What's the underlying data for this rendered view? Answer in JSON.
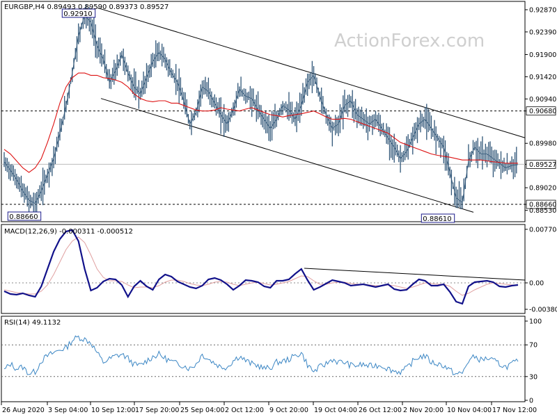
{
  "watermark": "ActionForex.com",
  "colors": {
    "price": "#2f5577",
    "ma": "#d11",
    "macd": "#11118a",
    "signal": "#e0a0a0",
    "rsi": "#3b86c4",
    "trend": "#000000",
    "dashed": "#000000",
    "box": "#1a1a8a"
  },
  "chart_data": [
    {
      "type": "line",
      "panel": "price",
      "title": "EURGBP,H4  0.89493 0.89590 0.89373 0.89527",
      "ylim": [
        0.883,
        0.9302
      ],
      "y_ticks": [
        "0.92870",
        "0.92390",
        "0.91900",
        "0.91420",
        "0.90940",
        "0.90680",
        "0.89980",
        "0.89527",
        "0.89020",
        "0.88660",
        "0.88530"
      ],
      "x_labels": [
        "26 Aug 2020",
        "3 Sep 04:00",
        "10 Sep 12:00",
        "17 Sep 20:00",
        "25 Sep 04:00",
        "2 Oct 12:00",
        "9 Oct 20:00",
        "19 Oct 04:00",
        "26 Oct 12:00",
        "2 Nov 20:00",
        "10 Nov 04:00",
        "17 Nov 12:00"
      ],
      "series": [
        {
          "values": [
            0.8958,
            0.894,
            0.892,
            0.8895,
            0.8875,
            0.8868,
            0.8895,
            0.893,
            0.8965,
            0.902,
            0.908,
            0.915,
            0.923,
            0.9275,
            0.926,
            0.921,
            0.918,
            0.913,
            0.9155,
            0.919,
            0.915,
            0.912,
            0.9105,
            0.914,
            0.9175,
            0.9195,
            0.918,
            0.915,
            0.913,
            0.909,
            0.904,
            0.9065,
            0.912,
            0.911,
            0.9085,
            0.906,
            0.904,
            0.907,
            0.9115,
            0.91,
            0.9095,
            0.907,
            0.905,
            0.903,
            0.905,
            0.908,
            0.907,
            0.905,
            0.908,
            0.913,
            0.9145,
            0.91,
            0.906,
            0.903,
            0.904,
            0.908,
            0.909,
            0.906,
            0.905,
            0.904,
            0.905,
            0.903,
            0.901,
            0.899,
            0.8965,
            0.898,
            0.901,
            0.904,
            0.905,
            0.903,
            0.901,
            0.899,
            0.8935,
            0.888,
            0.887,
            0.896,
            0.899,
            0.8975,
            0.8975,
            0.8965,
            0.8955,
            0.8945,
            0.895,
            0.8952
          ]
        },
        {
          "values": [
            0.8985,
            0.8975,
            0.896,
            0.8945,
            0.8935,
            0.8945,
            0.8965,
            0.9,
            0.904,
            0.9085,
            0.912,
            0.914,
            0.915,
            0.915,
            0.9145,
            0.9145,
            0.914,
            0.9138,
            0.9135,
            0.913,
            0.912,
            0.9105,
            0.9095,
            0.909,
            0.9088,
            0.909,
            0.909,
            0.9085,
            0.9085,
            0.908,
            0.9075,
            0.907,
            0.9068,
            0.9068,
            0.907,
            0.9075,
            0.9072,
            0.907,
            0.9068,
            0.9072,
            0.9075,
            0.907,
            0.9065,
            0.906,
            0.9058,
            0.9055,
            0.9058,
            0.906,
            0.9062,
            0.9065,
            0.9068,
            0.9062,
            0.9055,
            0.905,
            0.905,
            0.9052,
            0.905,
            0.9045,
            0.904,
            0.9035,
            0.903,
            0.9025,
            0.902,
            0.901,
            0.9,
            0.8995,
            0.899,
            0.8985,
            0.898,
            0.8975,
            0.8972,
            0.897,
            0.8968,
            0.8965,
            0.8962,
            0.8962,
            0.8962,
            0.8962,
            0.896,
            0.8958,
            0.8957,
            0.8955,
            0.8955,
            0.8955
          ]
        }
      ],
      "annotations": [
        "0.92910",
        "0.88660",
        "0.88610",
        "0.90680",
        "0.89527",
        "0.88660"
      ]
    },
    {
      "type": "line",
      "panel": "macd",
      "title": "MACD(12,26,9) -0.000311 -0.000512",
      "ylim": [
        -0.0042,
        0.0081
      ],
      "y_ticks": [
        "0.007704",
        "0.00",
        "-0.003804"
      ],
      "series": [
        {
          "values": [
            -0.0012,
            -0.0016,
            -0.0017,
            -0.0015,
            -0.0018,
            -0.002,
            -0.0005,
            0.002,
            0.0045,
            0.0063,
            0.0074,
            0.0076,
            0.006,
            0.002,
            -0.0011,
            -0.0007,
            0.0002,
            0.0006,
            0.0005,
            -0.0003,
            -0.002,
            -0.0005,
            0.0003,
            -0.0005,
            -0.001,
            0.0005,
            0.0012,
            0.0009,
            0.0002,
            -0.0002,
            -0.0006,
            -0.0008,
            -0.0004,
            0.0005,
            0.0007,
            0.0004,
            -0.0002,
            -0.001,
            -0.0004,
            0.0004,
            0.0003,
            0.0001,
            -0.0005,
            -0.0007,
            0.0003,
            0.0003,
            0.0005,
            0.0013,
            0.002,
            0.0004,
            -0.001,
            -0.0006,
            -0.0001,
            0.0004,
            0.0002,
            0.0,
            -0.0004,
            -0.0003,
            -0.0002,
            -0.0004,
            -0.0006,
            -0.0004,
            -0.0002,
            -0.0009,
            -0.0011,
            -0.001,
            -0.0002,
            0.0005,
            0.0003,
            -0.0004,
            -0.0004,
            -0.0002,
            -0.0013,
            -0.0027,
            -0.003,
            -0.0005,
            0.0001,
            0.0002,
            0.0003,
            0.0001,
            -0.0005,
            -0.0006,
            -0.0004,
            -0.0003
          ]
        },
        {
          "values": [
            -0.001,
            -0.0012,
            -0.0014,
            -0.0015,
            -0.0016,
            -0.0016,
            -0.0012,
            -0.0003,
            0.0012,
            0.003,
            0.0048,
            0.006,
            0.0066,
            0.0058,
            0.004,
            0.002,
            0.0008,
            0.0003,
            0.0003,
            0.0002,
            -0.0003,
            -0.0007,
            -0.0006,
            -0.0006,
            -0.0007,
            -0.0004,
            0.0001,
            0.0004,
            0.0004,
            0.0002,
            -0.0001,
            -0.0003,
            -0.0004,
            -0.0002,
            0.0001,
            0.0002,
            0.0001,
            -0.0002,
            -0.0004,
            -0.0002,
            0.0,
            0.0001,
            -0.0001,
            -0.0003,
            -0.0002,
            0.0,
            0.0002,
            0.0006,
            0.001,
            0.0009,
            0.0003,
            -0.0002,
            -0.0002,
            0.0,
            0.0001,
            0.0001,
            -0.0001,
            -0.0002,
            -0.0002,
            -0.0003,
            -0.0004,
            -0.0004,
            -0.0003,
            -0.0004,
            -0.0006,
            -0.0008,
            -0.0006,
            -0.0003,
            0.0,
            -0.0001,
            -0.0002,
            -0.0002,
            -0.0005,
            -0.0012,
            -0.0018,
            -0.0015,
            -0.001,
            -0.0006,
            -0.0002,
            0.0,
            -0.0001,
            -0.0002,
            -0.0003,
            -0.0003
          ]
        }
      ]
    },
    {
      "type": "line",
      "panel": "rsi",
      "title": "RSI(14) 49.1132",
      "ylim": [
        0,
        100
      ],
      "y_ticks": [
        "100",
        "70",
        "30",
        "0"
      ],
      "series": [
        {
          "values": [
            38,
            46,
            40,
            42,
            34,
            36,
            50,
            56,
            60,
            64,
            66,
            76,
            80,
            77,
            73,
            60,
            48,
            52,
            56,
            58,
            53,
            45,
            44,
            50,
            55,
            58,
            53,
            49,
            46,
            44,
            40,
            46,
            58,
            52,
            47,
            42,
            42,
            50,
            56,
            50,
            46,
            44,
            40,
            41,
            48,
            49,
            52,
            56,
            60,
            45,
            36,
            42,
            46,
            52,
            48,
            48,
            44,
            44,
            45,
            43,
            44,
            44,
            40,
            37,
            36,
            40,
            49,
            55,
            56,
            48,
            46,
            44,
            38,
            33,
            34,
            50,
            55,
            51,
            53,
            50,
            46,
            42,
            46,
            49
          ]
        }
      ]
    }
  ]
}
